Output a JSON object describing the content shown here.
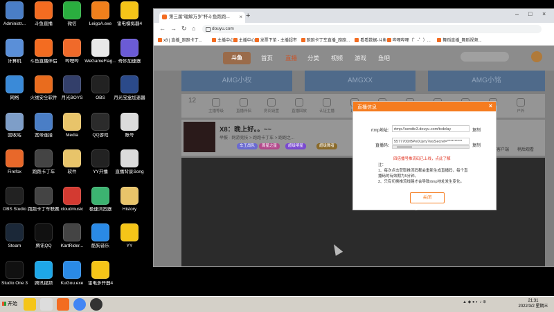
{
  "desktop": {
    "icons": [
      {
        "label": "Administr...",
        "icon": "user-icon",
        "color": "#4a7ec6"
      },
      {
        "label": "斗鱼直播",
        "icon": "douyu-icon",
        "color": "#f36c21"
      },
      {
        "label": "微信",
        "icon": "wechat-icon",
        "color": "#2aae3f"
      },
      {
        "label": "LeigoA.exe",
        "icon": "leigo-icon",
        "color": "#f0801c"
      },
      {
        "label": "雷电模拟器4",
        "icon": "ldplayer-icon",
        "color": "#f5c518"
      },
      {
        "label": "计算机",
        "icon": "computer-icon",
        "color": "#5a8fd8"
      },
      {
        "label": "斗鱼直播伴侣",
        "icon": "douyu-companion-icon",
        "color": "#f36c21"
      },
      {
        "label": "哔哩哔",
        "icon": "app-icon",
        "color": "#f06a2a"
      },
      {
        "label": "WeGameFlag...",
        "icon": "wegame-icon",
        "color": "#e8e8e8"
      },
      {
        "label": "奇妙加速器",
        "icon": "accelerator-icon",
        "color": "#6b5bd6"
      },
      {
        "label": "网络",
        "icon": "network-icon",
        "color": "#3a8ad8"
      },
      {
        "label": "火绒安全软件",
        "icon": "huorong-icon",
        "color": "#e96c1e"
      },
      {
        "label": "月光BOYS",
        "icon": "character-icon",
        "color": "#333f6a"
      },
      {
        "label": "OBS",
        "icon": "obs-icon",
        "color": "#222"
      },
      {
        "label": "月光宝盒加速器",
        "icon": "character-icon",
        "color": "#2b4a8a"
      },
      {
        "label": "回收站",
        "icon": "recycle-bin-icon",
        "color": "#7e9ec8"
      },
      {
        "label": "宽带连接",
        "icon": "broadband-icon",
        "color": "#4a7ec6"
      },
      {
        "label": "Media",
        "icon": "folder-icon",
        "color": "#e8c46a"
      },
      {
        "label": "QQ游戏",
        "icon": "qq-game-icon",
        "color": "#2b2b2b"
      },
      {
        "label": "账号",
        "icon": "document-icon",
        "color": "#dcdcdc"
      },
      {
        "label": "Firefox",
        "icon": "firefox-icon",
        "color": "#e8682a"
      },
      {
        "label": "跑跑卡丁车",
        "icon": "kart-icon",
        "color": "#444"
      },
      {
        "label": "软件",
        "icon": "folder-icon",
        "color": "#e8c46a"
      },
      {
        "label": "YY开播",
        "icon": "yy-icon",
        "color": "#222"
      },
      {
        "label": "直播背景Song",
        "icon": "document-icon",
        "color": "#dcdcdc"
      },
      {
        "label": "OBS Studio",
        "icon": "obs-icon",
        "color": "#222"
      },
      {
        "label": "跑跑卡丁车联赛版",
        "icon": "kart-icon",
        "color": "#444"
      },
      {
        "label": "cloudmusic",
        "icon": "netease-music-icon",
        "color": "#d33a31"
      },
      {
        "label": "极速浏览器",
        "icon": "browser-icon",
        "color": "#3cb371"
      },
      {
        "label": "History",
        "icon": "folder-icon",
        "color": "#e8c46a"
      },
      {
        "label": "Steam",
        "icon": "steam-icon",
        "color": "#1b2838"
      },
      {
        "label": "腾讯QQ",
        "icon": "qq-icon",
        "color": "#111"
      },
      {
        "label": "KartRider...",
        "icon": "kart-icon",
        "color": "#444"
      },
      {
        "label": "酷狗音乐",
        "icon": "kugou-icon",
        "color": "#2a8ae6"
      },
      {
        "label": "YY",
        "icon": "yy-icon",
        "color": "#f5c518"
      },
      {
        "label": "Studio One 3",
        "icon": "studio-one-icon",
        "color": "#111"
      },
      {
        "label": "腾讯视频",
        "icon": "tencent-video-icon",
        "color": "#1ea7e8"
      },
      {
        "label": "KuGou.exe",
        "icon": "kugou-icon",
        "color": "#2a8ae6"
      },
      {
        "label": "雷电多开器4",
        "icon": "ldplayer-multi-icon",
        "color": "#f5c518"
      }
    ]
  },
  "browser": {
    "tab_title": "第三届“理解万岁”杯斗鱼跑跑...",
    "address": "douyu.com",
    "bookmarks": [
      "x8 | 直播_跑跑卡丁...",
      "主播中心",
      "主播中心",
      "发票下单 - 主播超市",
      "跑跑卡丁车直播_跑跑...",
      "看看数据-斗鱼",
      "哔哩哔哩（゜-゜）...",
      "舞蹈直播_舞蹈视频..."
    ]
  },
  "site": {
    "logo": "斗鱼",
    "nav": [
      "首页",
      "直播",
      "分类",
      "视频",
      "游戏",
      "鱼吧"
    ],
    "banners": [
      "AMG小权",
      "AMGXX",
      "AMG小铭"
    ],
    "icon_row": [
      "主播等级",
      "直播伴侣",
      "房间设置",
      "直播回放",
      "认证主播",
      "超级",
      "鱼塘",
      "直播数据",
      "直播间",
      "关注",
      "直播",
      "户外"
    ],
    "icon_row_count": "12",
    "profile_title": "X8：晚上好。。~~",
    "profile_meta": "举报 · 网游竞技 > 跑跑卡丁车 > 跑跑之...",
    "tags": [
      "车王战队",
      "周星之星",
      "超级明星",
      "超级舞者"
    ],
    "right_actions": [
      "分享",
      "客户端",
      "稍后观看"
    ]
  },
  "dialog": {
    "title": "直播信息",
    "close": "×",
    "rtmp_label": "rtmp地址：",
    "rtmp_value": "rtmp://sendtc3.douyu.com/tcdelay",
    "stream_label": "直播码：",
    "stream_value": "5577700rBPe0Uyry?wsSecret=**********",
    "copy": "复制",
    "warning": "四倍播号推流码已上线，点此了解",
    "warning_link": "点此了解",
    "notes_title": "注：",
    "notes": [
      "1、每次点击获取推流码都会重新生成直播码，每个直",
      "播码的有效期为5分钟。",
      "2、只有切换推流线路才会导致rtmp地址发生变化。"
    ],
    "ok": "关闭"
  },
  "taskbar": {
    "start": "开始",
    "time": "21:31",
    "date": "2022/3/2 星期三"
  }
}
